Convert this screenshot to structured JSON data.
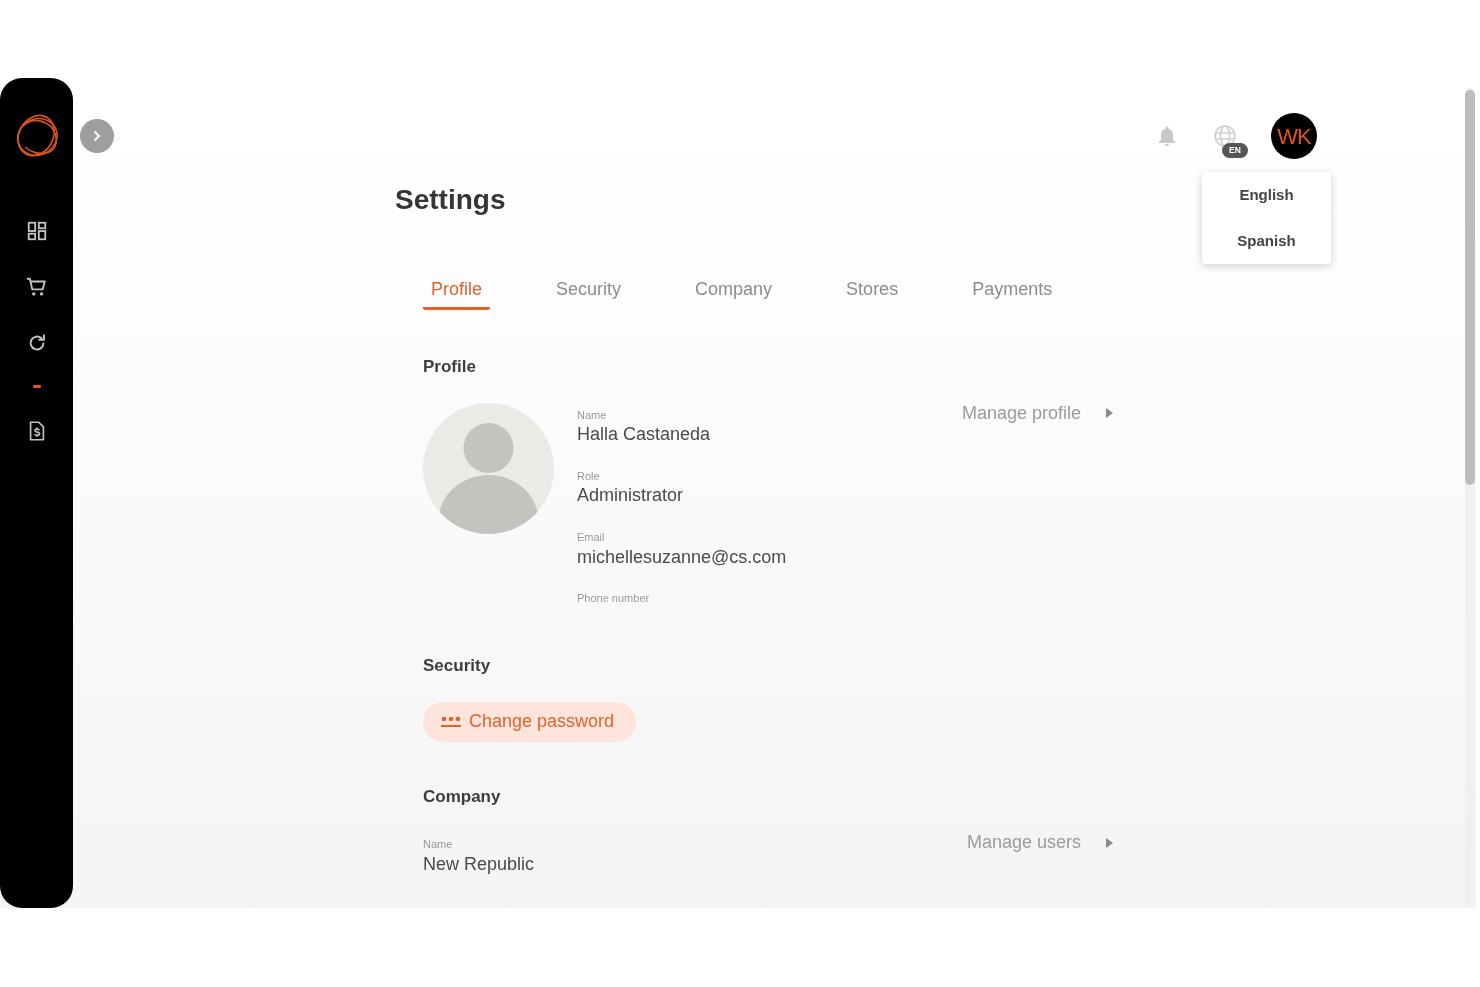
{
  "sidebar": {
    "items": [
      {
        "kind": "dashboard"
      },
      {
        "kind": "cart"
      },
      {
        "kind": "refresh"
      },
      {
        "kind": "dash"
      },
      {
        "kind": "invoice"
      }
    ]
  },
  "topbar": {
    "language_badge": "EN",
    "avatar_initials": "WK",
    "language_menu": [
      "English",
      "Spanish"
    ]
  },
  "page": {
    "title": "Settings"
  },
  "tabs": [
    {
      "label": "Profile",
      "selected": true
    },
    {
      "label": "Security",
      "selected": false
    },
    {
      "label": "Company",
      "selected": false
    },
    {
      "label": "Stores",
      "selected": false
    },
    {
      "label": "Payments",
      "selected": false
    }
  ],
  "sections": [
    {
      "kind": "profile",
      "heading": "Profile",
      "fields": [
        {
          "label": "Name",
          "value": "Halla Castaneda"
        },
        {
          "label": "Role",
          "value": "Administrator"
        },
        {
          "label": "Email",
          "value": "michellesuzanne@cs.com"
        },
        {
          "label": "Phone number"
        }
      ],
      "action": "Manage profile"
    },
    {
      "kind": "security",
      "heading": "Security",
      "button": "Change password"
    },
    {
      "kind": "company",
      "heading": "Company",
      "fields": [
        {
          "label": "Name",
          "value": "New Republic"
        }
      ],
      "action": "Manage users"
    }
  ]
}
